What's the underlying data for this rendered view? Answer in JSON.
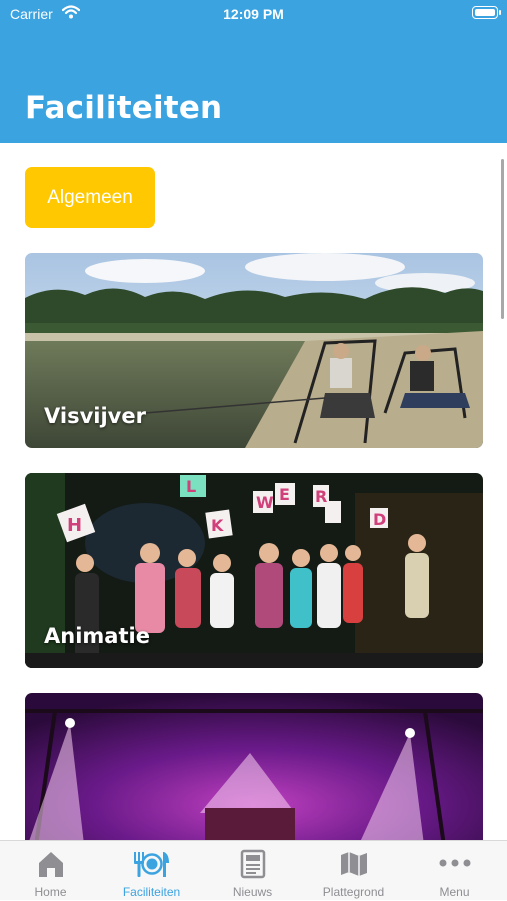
{
  "status_bar": {
    "carrier": "Carrier",
    "time": "12:09 PM"
  },
  "header": {
    "title": "Faciliteiten",
    "color": "#3BA3E0"
  },
  "filter": {
    "label": "Algemeen",
    "color": "#FFC800"
  },
  "cards": [
    {
      "label": "Visvijver"
    },
    {
      "label": "Animatie"
    },
    {
      "label": ""
    }
  ],
  "tabbar": {
    "active": "Faciliteiten",
    "items": [
      {
        "label": "Home",
        "icon": "home-icon"
      },
      {
        "label": "Faciliteiten",
        "icon": "utensils-icon"
      },
      {
        "label": "Nieuws",
        "icon": "newspaper-icon"
      },
      {
        "label": "Plattegrond",
        "icon": "map-icon"
      },
      {
        "label": "Menu",
        "icon": "more-dots-icon"
      }
    ]
  }
}
